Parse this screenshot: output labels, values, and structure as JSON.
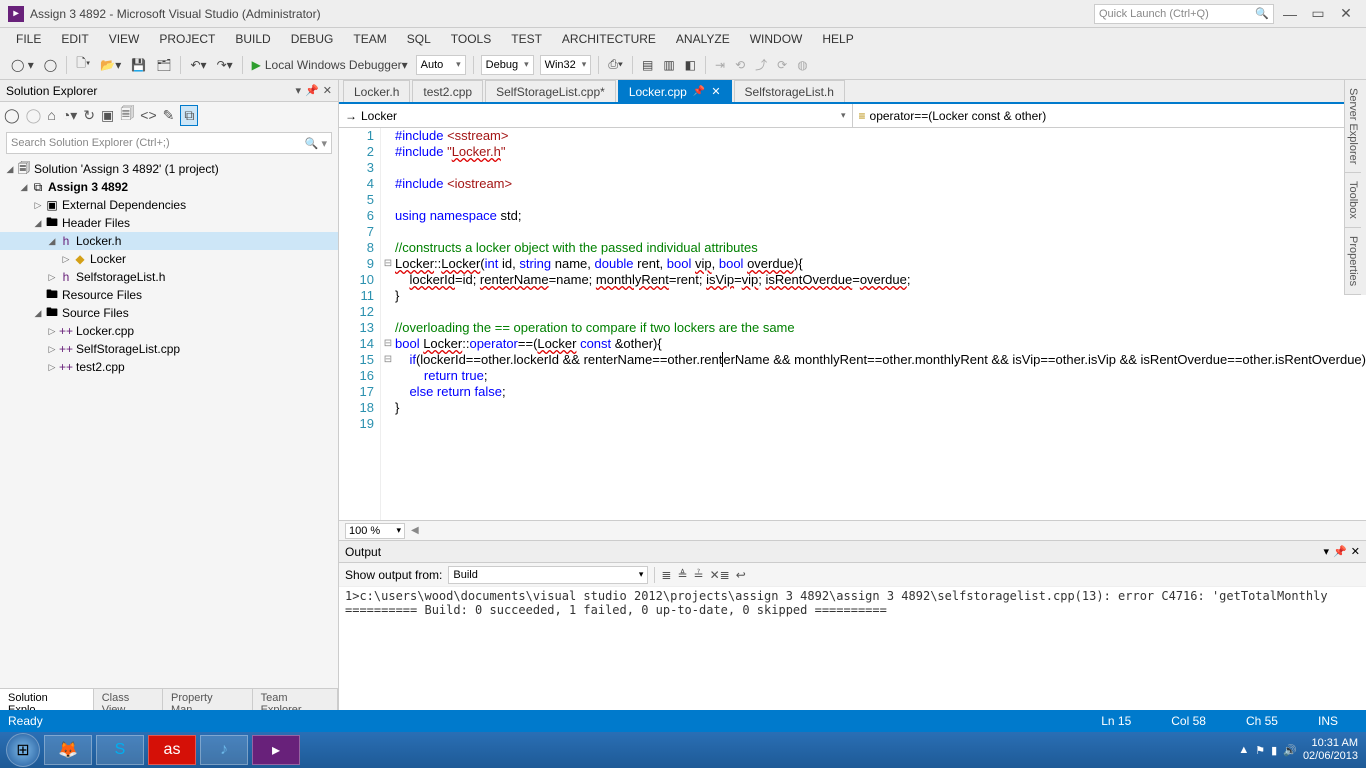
{
  "window": {
    "title": "Assign 3 4892 - Microsoft Visual Studio (Administrator)",
    "quick_launch_placeholder": "Quick Launch (Ctrl+Q)"
  },
  "menu": [
    "FILE",
    "EDIT",
    "VIEW",
    "PROJECT",
    "BUILD",
    "DEBUG",
    "TEAM",
    "SQL",
    "TOOLS",
    "TEST",
    "ARCHITECTURE",
    "ANALYZE",
    "WINDOW",
    "HELP"
  ],
  "toolbar": {
    "debugger_label": "Local Windows Debugger",
    "config_platform": "Auto",
    "config_solution": "Debug",
    "config_target": "Win32"
  },
  "solution_explorer": {
    "title": "Solution Explorer",
    "search_placeholder": "Search Solution Explorer (Ctrl+;)",
    "tree": {
      "solution": "Solution 'Assign 3 4892' (1 project)",
      "project": "Assign 3 4892",
      "ext_deps": "External Dependencies",
      "header_files": "Header Files",
      "locker_h": "Locker.h",
      "locker_class": "Locker",
      "selfstoragelist_h": "SelfstorageList.h",
      "resource_files": "Resource Files",
      "source_files": "Source Files",
      "locker_cpp": "Locker.cpp",
      "selfstoragelist_cpp": "SelfStorageList.cpp",
      "test2_cpp": "test2.cpp"
    },
    "tabs": [
      "Solution Explo...",
      "Class View",
      "Property Man...",
      "Team Explorer"
    ]
  },
  "doc_tabs": [
    {
      "label": "Locker.h",
      "active": false
    },
    {
      "label": "test2.cpp",
      "active": false
    },
    {
      "label": "SelfStorageList.cpp*",
      "active": false
    },
    {
      "label": "Locker.cpp",
      "active": true,
      "pinned": true
    },
    {
      "label": "SelfstorageList.h",
      "active": false
    }
  ],
  "nav": {
    "scope": "Locker",
    "member": "operator==(Locker const & other)"
  },
  "code": {
    "lines": [
      {
        "n": 1,
        "html": "<span class='kw'>#include</span> <span class='str'>&lt;sstream&gt;</span>"
      },
      {
        "n": 2,
        "html": "<span class='kw'>#include</span> <span class='str'>\"<span class='squig'>Locker.h</span>\"</span>"
      },
      {
        "n": 3,
        "html": ""
      },
      {
        "n": 4,
        "html": "<span class='kw'>#include</span> <span class='str'>&lt;iostream&gt;</span>"
      },
      {
        "n": 5,
        "html": ""
      },
      {
        "n": 6,
        "html": "<span class='kw'>using namespace</span> std;"
      },
      {
        "n": 7,
        "html": ""
      },
      {
        "n": 8,
        "html": "<span class='cmt'>//constructs a locker object with the passed individual attributes</span>"
      },
      {
        "n": 9,
        "fold": "⊟",
        "html": "<span class='squig'>Locker</span>::<span class='squig'>Locker</span>(<span class='kw'>int</span> id, <span class='type'>string</span> name, <span class='kw'>double</span> rent, <span class='kw'>bool</span> <span class='squig'>vip</span>, <span class='kw'>bool</span> <span class='squig'>overdue</span>){"
      },
      {
        "n": 10,
        "html": "    <span class='squig'>lockerId</span>=id; <span class='squig'>renterName</span>=name; <span class='squig'>monthlyRent</span>=rent; <span class='squig'>isVip</span>=<span class='squig'>vip</span>; <span class='squig'>isRentOverdue</span>=<span class='squig'>overdue</span>;"
      },
      {
        "n": 11,
        "html": "}"
      },
      {
        "n": 12,
        "html": ""
      },
      {
        "n": 13,
        "html": "<span class='cmt'>//overloading the == operation to compare if two lockers are the same</span>"
      },
      {
        "n": 14,
        "fold": "⊟",
        "html": "<span class='kw'>bool</span> <span class='squig'>Locker</span>::<span class='kw'>operator</span>==(<span class='squig'>Locker</span> <span class='kw'>const</span> &amp;other){"
      },
      {
        "n": 15,
        "fold": "⊟",
        "html": "    <span class='kw'>if</span>(lockerId==other.lockerId &amp;&amp; renterName==other.rent<span style='border-left:1px solid #000'></span>erName &amp;&amp; monthlyRent==other.monthlyRent &amp;&amp; isVip==other.isVip &amp;&amp; isRentOverdue==other.isRentOverdue)"
      },
      {
        "n": 16,
        "html": "        <span class='kw'>return true</span>;"
      },
      {
        "n": 17,
        "html": "    <span class='kw'>else return false</span>;"
      },
      {
        "n": 18,
        "html": "}"
      },
      {
        "n": 19,
        "html": ""
      }
    ],
    "zoom": "100 %"
  },
  "output": {
    "title": "Output",
    "show_label": "Show output from:",
    "source": "Build",
    "body": "1>c:\\users\\wood\\documents\\visual studio 2012\\projects\\assign 3 4892\\assign 3 4892\\selfstoragelist.cpp(13): error C4716: 'getTotalMonthly\n========== Build: 0 succeeded, 1 failed, 0 up-to-date, 0 skipped =========="
  },
  "right_tabs": [
    "Server Explorer",
    "Toolbox",
    "Properties"
  ],
  "status": {
    "ready": "Ready",
    "ln": "Ln 15",
    "col": "Col 58",
    "ch": "Ch 55",
    "ins": "INS"
  },
  "tray": {
    "time": "10:31 AM",
    "date": "02/06/2013"
  }
}
